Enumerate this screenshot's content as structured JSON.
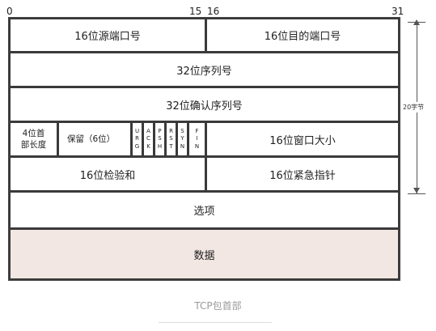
{
  "bit_numbers": [
    "0",
    "15",
    "16",
    "31"
  ],
  "fields": {
    "src_port": "16位源端口号",
    "dst_port": "16位目的端口号",
    "seq": "32位序列号",
    "ack_num": "32位确认序列号",
    "header_len_line1": "4位首",
    "header_len_line2": "部长度",
    "reserved": "保留（6位）",
    "flags": [
      [
        "U",
        "R",
        "G"
      ],
      [
        "A",
        "C",
        "K"
      ],
      [
        "P",
        "S",
        "H"
      ],
      [
        "R",
        "S",
        "T"
      ],
      [
        "S",
        "Y",
        "N"
      ],
      [
        "F",
        "I",
        "N"
      ]
    ],
    "window": "16位窗口大小",
    "checksum": "16位检验和",
    "urgent": "16位紧急指针",
    "options": "选项",
    "data": "数据"
  },
  "bracket_label": "20字节",
  "caption": "TCP包首部",
  "colors": {
    "border": "#3a3a3a",
    "data_fill": "#f2e7e2",
    "caption": "#9a9a9a"
  }
}
